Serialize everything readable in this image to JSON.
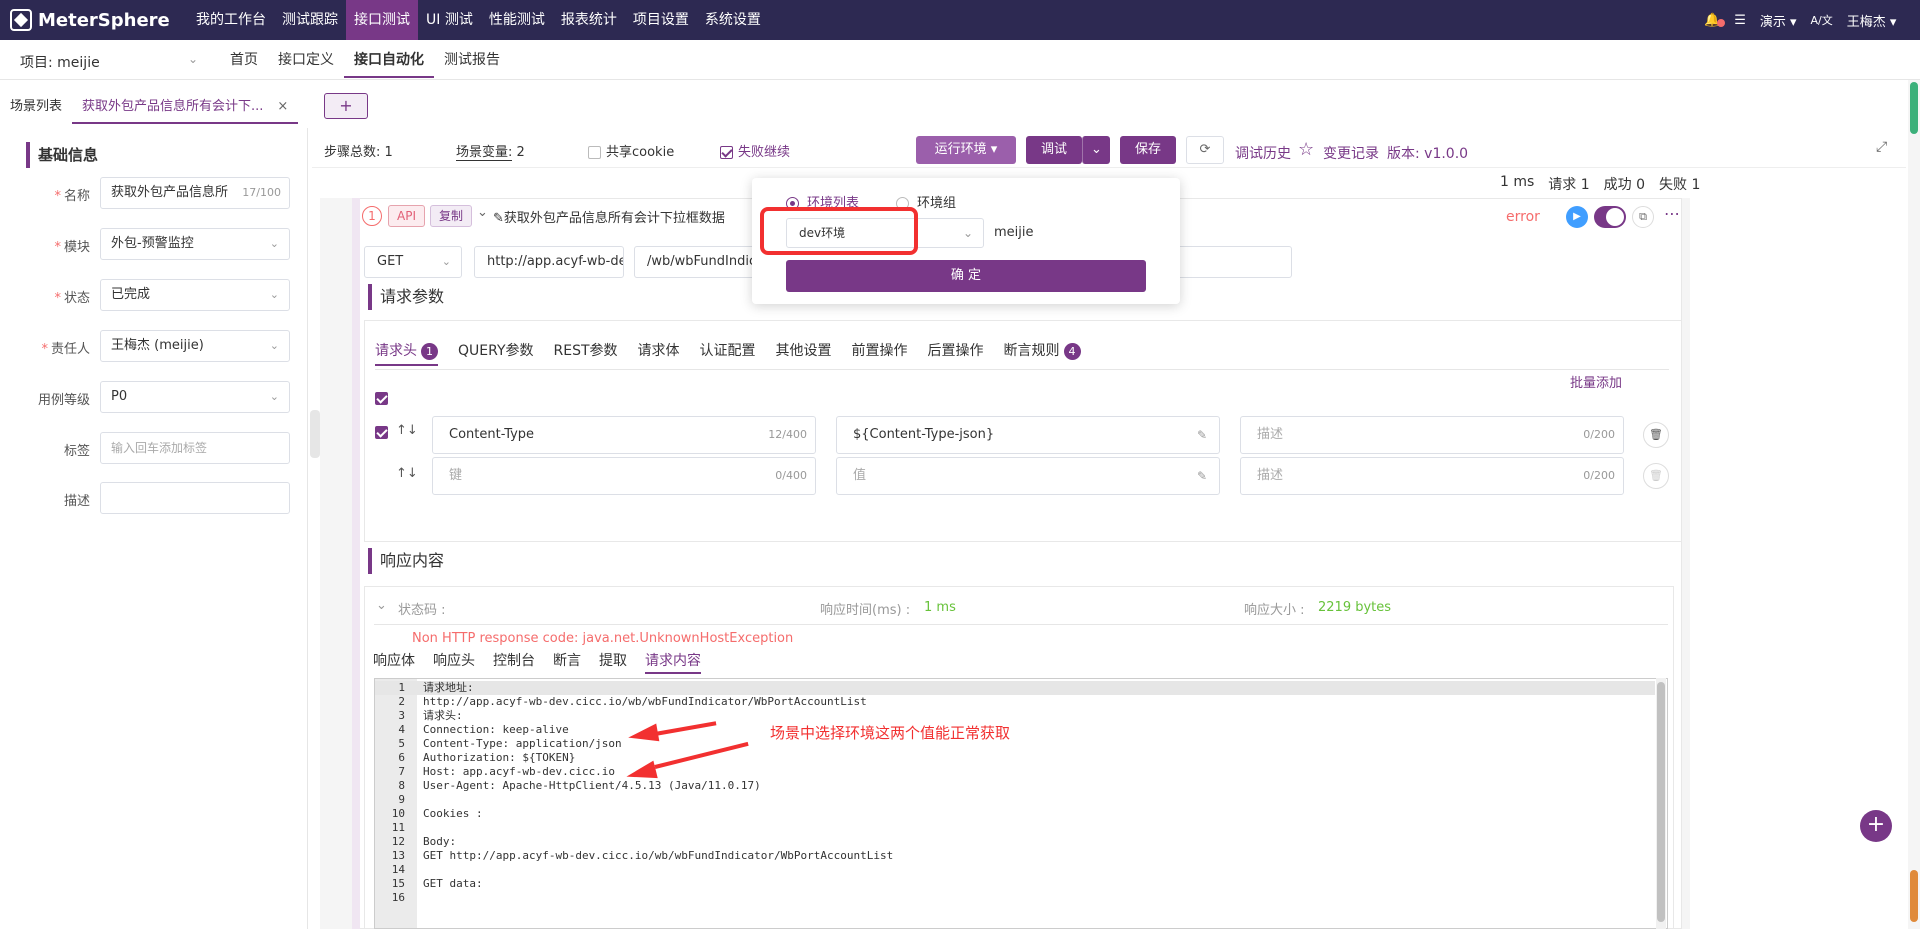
{
  "app": {
    "brand": "MeterSphere"
  },
  "nav": [
    "我的工作台",
    "测试跟踪",
    "接口测试",
    "UI 测试",
    "性能测试",
    "报表统计",
    "项目设置",
    "系统设置"
  ],
  "top_right": {
    "bell_icon": "bell-icon",
    "list_icon": "list-icon",
    "workspace": "演示",
    "lang": "A/文",
    "user": "王梅杰"
  },
  "project": {
    "label": "项目: meijie"
  },
  "subnav": [
    "首页",
    "接口定义",
    "接口自动化",
    "测试报告"
  ],
  "tabs": {
    "scene_list": "场景列表",
    "current": "获取外包产品信息所有会计下...",
    "close": "×",
    "add": "+"
  },
  "basic": {
    "title": "基础信息",
    "fields": [
      {
        "label": "名称",
        "required": true,
        "value": "获取外包产品信息所",
        "count": "17/100"
      },
      {
        "label": "模块",
        "required": true,
        "value": "外包-预警监控"
      },
      {
        "label": "状态",
        "required": true,
        "value": "已完成"
      },
      {
        "label": "责任人",
        "required": true,
        "value": "王梅杰 (meijie)"
      },
      {
        "label": "用例等级",
        "required": false,
        "value": "P0"
      },
      {
        "label": "标签",
        "required": false,
        "placeholder": "输入回车添加标签"
      },
      {
        "label": "描述",
        "required": false,
        "value": ""
      }
    ]
  },
  "summary": {
    "steps_label": "步骤总数:",
    "steps": "1",
    "vars_label": "场景变量:",
    "vars": "2",
    "share_cookie": "共享cookie",
    "fail_continue": "失败继续",
    "env_btn": "运行环境",
    "debug_btn": "调试",
    "save_btn": "保存",
    "history": "调试历史",
    "changes": "变更记录",
    "version": "版本: v1.0.0"
  },
  "stats": {
    "time": "1 ms",
    "requests": "请求 1",
    "success": "成功 0",
    "fail": "失败 1"
  },
  "step": {
    "index": "1",
    "type": "API",
    "copy": "复制",
    "name": "获取外包产品信息所有会计下拉框数据",
    "status": "error",
    "method": "GET",
    "domain": "http://app.acyf-wb-de",
    "path": "/wb/wbFundIndicato"
  },
  "request_params": {
    "title": "请求参数",
    "tabs": [
      "请求头",
      "QUERY参数",
      "REST参数",
      "请求体",
      "认证配置",
      "其他设置",
      "前置操作",
      "后置操作",
      "断言规则"
    ],
    "header_badge": "1",
    "assert_badge": "4",
    "batch_add": "批量添加",
    "rows": [
      {
        "key": "Content-Type",
        "key_count": "12/400",
        "value": "${Content-Type-json}",
        "desc_placeholder": "描述",
        "desc_count": "0/200"
      },
      {
        "key_placeholder": "键",
        "key_count": "0/400",
        "value_placeholder": "值",
        "desc_placeholder": "描述",
        "desc_count": "0/200"
      }
    ]
  },
  "response": {
    "title": "响应内容",
    "status_label": "状态码 :",
    "time_label": "响应时间(ms) :",
    "time": "1 ms",
    "size_label": "响应大小 :",
    "size": "2219 bytes",
    "error": "Non HTTP response code: java.net.UnknownHostException",
    "tabs": [
      "响应体",
      "响应头",
      "控制台",
      "断言",
      "提取",
      "请求内容"
    ],
    "code_lines": [
      "请求地址:",
      "http://app.acyf-wb-dev.cicc.io/wb/wbFundIndicator/WbPortAccountList",
      "请求头:",
      "Connection: keep-alive",
      "Content-Type: application/json",
      "Authorization: ${TOKEN}",
      "Host: app.acyf-wb-dev.cicc.io",
      "User-Agent: Apache-HttpClient/4.5.13 (Java/11.0.17)",
      "",
      "Cookies :",
      "",
      "Body:",
      "GET http://app.acyf-wb-dev.cicc.io/wb/wbFundIndicator/WbPortAccountList",
      "",
      "GET data:",
      ""
    ]
  },
  "env_popover": {
    "opt_list": "环境列表",
    "opt_group": "环境组",
    "env_value": "dev环境",
    "project": "meijie",
    "confirm": "确 定"
  },
  "annotation": {
    "text": "场景中选择环境这两个值能正常获取"
  },
  "colors": {
    "brand": "#783887",
    "topbar": "#2d2952",
    "annotation": "#f23030"
  }
}
